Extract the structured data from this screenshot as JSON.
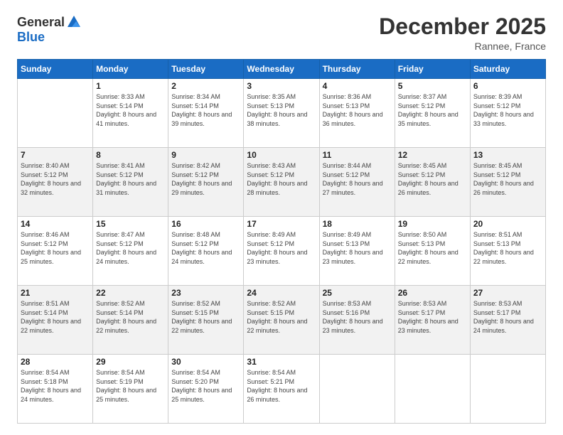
{
  "header": {
    "logo": {
      "general": "General",
      "blue": "Blue"
    },
    "title": "December 2025",
    "location": "Rannee, France"
  },
  "weekdays": [
    "Sunday",
    "Monday",
    "Tuesday",
    "Wednesday",
    "Thursday",
    "Friday",
    "Saturday"
  ],
  "weeks": [
    [
      {
        "day": "",
        "sunrise": "",
        "sunset": "",
        "daylight": "",
        "empty": true
      },
      {
        "day": "1",
        "sunrise": "Sunrise: 8:33 AM",
        "sunset": "Sunset: 5:14 PM",
        "daylight": "Daylight: 8 hours and 41 minutes."
      },
      {
        "day": "2",
        "sunrise": "Sunrise: 8:34 AM",
        "sunset": "Sunset: 5:14 PM",
        "daylight": "Daylight: 8 hours and 39 minutes."
      },
      {
        "day": "3",
        "sunrise": "Sunrise: 8:35 AM",
        "sunset": "Sunset: 5:13 PM",
        "daylight": "Daylight: 8 hours and 38 minutes."
      },
      {
        "day": "4",
        "sunrise": "Sunrise: 8:36 AM",
        "sunset": "Sunset: 5:13 PM",
        "daylight": "Daylight: 8 hours and 36 minutes."
      },
      {
        "day": "5",
        "sunrise": "Sunrise: 8:37 AM",
        "sunset": "Sunset: 5:12 PM",
        "daylight": "Daylight: 8 hours and 35 minutes."
      },
      {
        "day": "6",
        "sunrise": "Sunrise: 8:39 AM",
        "sunset": "Sunset: 5:12 PM",
        "daylight": "Daylight: 8 hours and 33 minutes."
      }
    ],
    [
      {
        "day": "7",
        "sunrise": "Sunrise: 8:40 AM",
        "sunset": "Sunset: 5:12 PM",
        "daylight": "Daylight: 8 hours and 32 minutes."
      },
      {
        "day": "8",
        "sunrise": "Sunrise: 8:41 AM",
        "sunset": "Sunset: 5:12 PM",
        "daylight": "Daylight: 8 hours and 31 minutes."
      },
      {
        "day": "9",
        "sunrise": "Sunrise: 8:42 AM",
        "sunset": "Sunset: 5:12 PM",
        "daylight": "Daylight: 8 hours and 29 minutes."
      },
      {
        "day": "10",
        "sunrise": "Sunrise: 8:43 AM",
        "sunset": "Sunset: 5:12 PM",
        "daylight": "Daylight: 8 hours and 28 minutes."
      },
      {
        "day": "11",
        "sunrise": "Sunrise: 8:44 AM",
        "sunset": "Sunset: 5:12 PM",
        "daylight": "Daylight: 8 hours and 27 minutes."
      },
      {
        "day": "12",
        "sunrise": "Sunrise: 8:45 AM",
        "sunset": "Sunset: 5:12 PM",
        "daylight": "Daylight: 8 hours and 26 minutes."
      },
      {
        "day": "13",
        "sunrise": "Sunrise: 8:45 AM",
        "sunset": "Sunset: 5:12 PM",
        "daylight": "Daylight: 8 hours and 26 minutes."
      }
    ],
    [
      {
        "day": "14",
        "sunrise": "Sunrise: 8:46 AM",
        "sunset": "Sunset: 5:12 PM",
        "daylight": "Daylight: 8 hours and 25 minutes."
      },
      {
        "day": "15",
        "sunrise": "Sunrise: 8:47 AM",
        "sunset": "Sunset: 5:12 PM",
        "daylight": "Daylight: 8 hours and 24 minutes."
      },
      {
        "day": "16",
        "sunrise": "Sunrise: 8:48 AM",
        "sunset": "Sunset: 5:12 PM",
        "daylight": "Daylight: 8 hours and 24 minutes."
      },
      {
        "day": "17",
        "sunrise": "Sunrise: 8:49 AM",
        "sunset": "Sunset: 5:12 PM",
        "daylight": "Daylight: 8 hours and 23 minutes."
      },
      {
        "day": "18",
        "sunrise": "Sunrise: 8:49 AM",
        "sunset": "Sunset: 5:13 PM",
        "daylight": "Daylight: 8 hours and 23 minutes."
      },
      {
        "day": "19",
        "sunrise": "Sunrise: 8:50 AM",
        "sunset": "Sunset: 5:13 PM",
        "daylight": "Daylight: 8 hours and 22 minutes."
      },
      {
        "day": "20",
        "sunrise": "Sunrise: 8:51 AM",
        "sunset": "Sunset: 5:13 PM",
        "daylight": "Daylight: 8 hours and 22 minutes."
      }
    ],
    [
      {
        "day": "21",
        "sunrise": "Sunrise: 8:51 AM",
        "sunset": "Sunset: 5:14 PM",
        "daylight": "Daylight: 8 hours and 22 minutes."
      },
      {
        "day": "22",
        "sunrise": "Sunrise: 8:52 AM",
        "sunset": "Sunset: 5:14 PM",
        "daylight": "Daylight: 8 hours and 22 minutes."
      },
      {
        "day": "23",
        "sunrise": "Sunrise: 8:52 AM",
        "sunset": "Sunset: 5:15 PM",
        "daylight": "Daylight: 8 hours and 22 minutes."
      },
      {
        "day": "24",
        "sunrise": "Sunrise: 8:52 AM",
        "sunset": "Sunset: 5:15 PM",
        "daylight": "Daylight: 8 hours and 22 minutes."
      },
      {
        "day": "25",
        "sunrise": "Sunrise: 8:53 AM",
        "sunset": "Sunset: 5:16 PM",
        "daylight": "Daylight: 8 hours and 23 minutes."
      },
      {
        "day": "26",
        "sunrise": "Sunrise: 8:53 AM",
        "sunset": "Sunset: 5:17 PM",
        "daylight": "Daylight: 8 hours and 23 minutes."
      },
      {
        "day": "27",
        "sunrise": "Sunrise: 8:53 AM",
        "sunset": "Sunset: 5:17 PM",
        "daylight": "Daylight: 8 hours and 24 minutes."
      }
    ],
    [
      {
        "day": "28",
        "sunrise": "Sunrise: 8:54 AM",
        "sunset": "Sunset: 5:18 PM",
        "daylight": "Daylight: 8 hours and 24 minutes."
      },
      {
        "day": "29",
        "sunrise": "Sunrise: 8:54 AM",
        "sunset": "Sunset: 5:19 PM",
        "daylight": "Daylight: 8 hours and 25 minutes."
      },
      {
        "day": "30",
        "sunrise": "Sunrise: 8:54 AM",
        "sunset": "Sunset: 5:20 PM",
        "daylight": "Daylight: 8 hours and 25 minutes."
      },
      {
        "day": "31",
        "sunrise": "Sunrise: 8:54 AM",
        "sunset": "Sunset: 5:21 PM",
        "daylight": "Daylight: 8 hours and 26 minutes."
      },
      {
        "day": "",
        "sunrise": "",
        "sunset": "",
        "daylight": "",
        "empty": true
      },
      {
        "day": "",
        "sunrise": "",
        "sunset": "",
        "daylight": "",
        "empty": true
      },
      {
        "day": "",
        "sunrise": "",
        "sunset": "",
        "daylight": "",
        "empty": true
      }
    ]
  ]
}
